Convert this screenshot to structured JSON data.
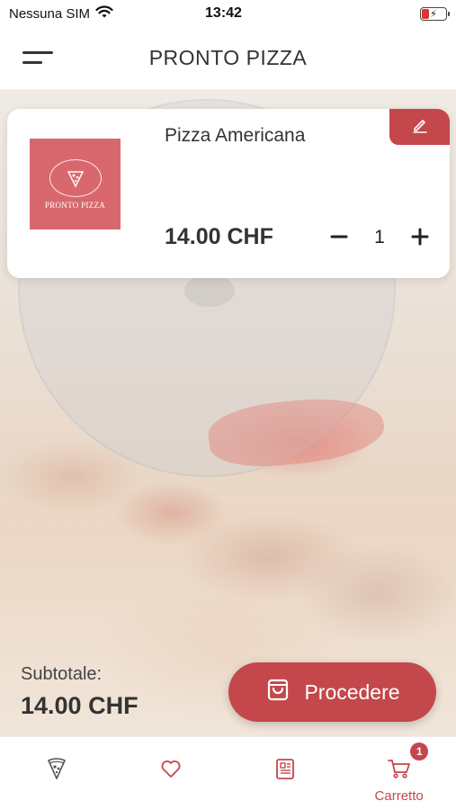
{
  "status_bar": {
    "carrier": "Nessuna SIM",
    "time": "13:42"
  },
  "header": {
    "title": "PRONTO PIZZA"
  },
  "cart_item": {
    "name": "Pizza Americana",
    "price": "14.00 CHF",
    "quantity": "1",
    "image_logo_text": "PRONTO PIZZA"
  },
  "summary": {
    "subtotal_label": "Subtotale:",
    "subtotal_value": "14.00 CHF",
    "proceed_label": "Procedere"
  },
  "tab_bar": {
    "tabs": [
      {
        "icon": "pizza-icon",
        "label": ""
      },
      {
        "icon": "heart-icon",
        "label": ""
      },
      {
        "icon": "menu-list-icon",
        "label": ""
      },
      {
        "icon": "cart-icon",
        "label": "Carretto",
        "badge": "1",
        "active": true
      }
    ]
  },
  "colors": {
    "accent": "#c4474b",
    "text": "#333333",
    "background": "#ffffff"
  }
}
